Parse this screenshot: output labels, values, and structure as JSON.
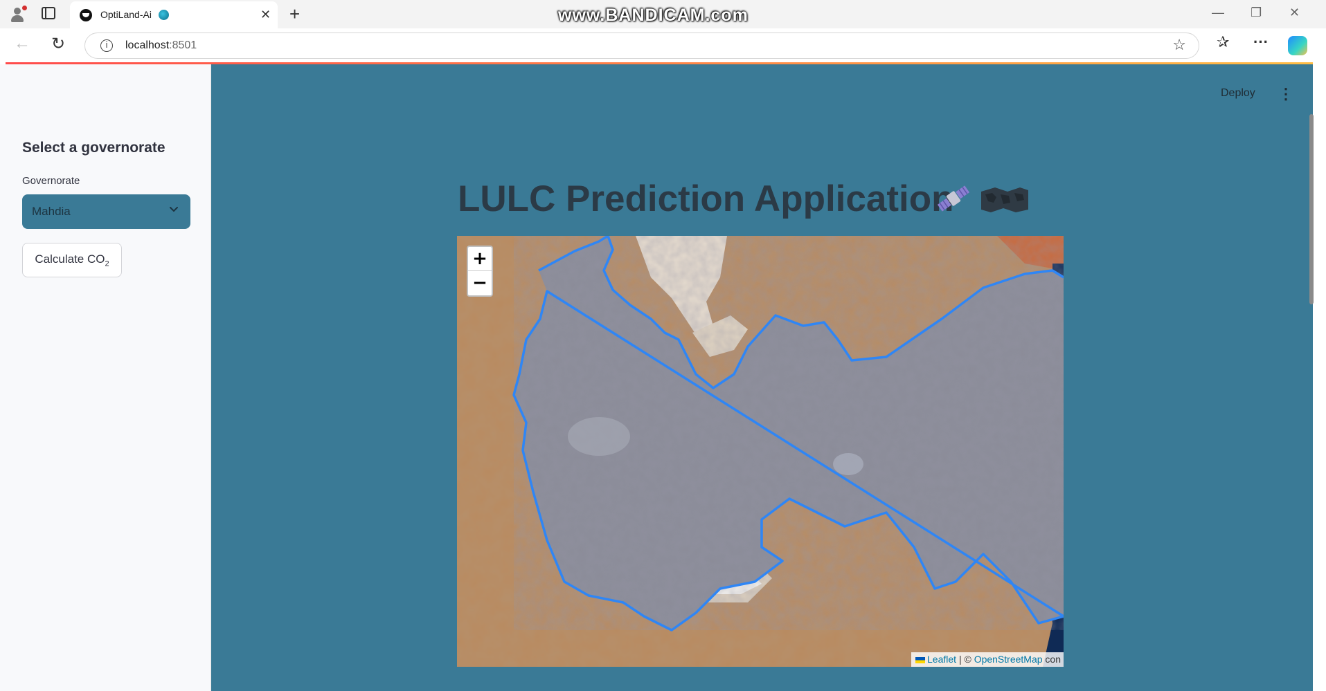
{
  "browser": {
    "tab_title": "OptiLand-Ai",
    "url_host": "localhost",
    "url_port": ":8501",
    "watermark": "www.BANDICAM.com",
    "icons": [
      "profile-icon",
      "tab-actions-icon",
      "close-icon",
      "new-tab-icon",
      "back-icon",
      "reload-icon",
      "site-info-icon",
      "favorite-star-icon",
      "favorites-icon",
      "more-icon",
      "copilot-icon"
    ]
  },
  "sidebar": {
    "heading": "Select a governorate",
    "select_label": "Governorate",
    "selected_governorate": "Mahdia",
    "calc_button_prefix": "Calculate CO",
    "calc_button_sub": "2"
  },
  "toolbar": {
    "deploy_label": "Deploy",
    "menu_icon": "⋮"
  },
  "main": {
    "title": "LULC Prediction Application",
    "title_emojis": [
      "satellite-emoji",
      "world-map-emoji"
    ]
  },
  "map": {
    "zoom_in": "+",
    "zoom_out": "−",
    "attribution_leaflet": "Leaflet",
    "attribution_sep": " | © ",
    "attribution_osm": "OpenStreetMap",
    "attribution_tail": " con"
  },
  "colors": {
    "app_background": "#3a7a96",
    "sidebar_background": "#f8f9fb",
    "boundary_stroke": "#2f86f5",
    "title_color": "#2b3a46"
  }
}
